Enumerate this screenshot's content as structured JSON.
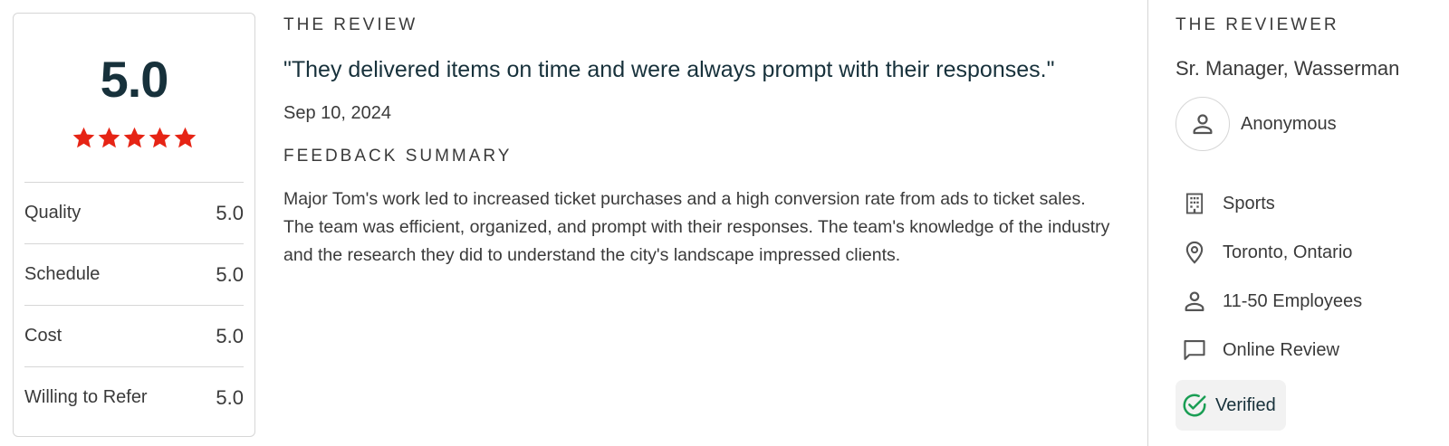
{
  "scorecard": {
    "overall": "5.0",
    "stars": 5,
    "star_color": "#e62415",
    "ratings": [
      {
        "label": "Quality",
        "value": "5.0"
      },
      {
        "label": "Schedule",
        "value": "5.0"
      },
      {
        "label": "Cost",
        "value": "5.0"
      },
      {
        "label": "Willing to Refer",
        "value": "5.0"
      }
    ]
  },
  "review": {
    "heading": "THE REVIEW",
    "quote": "\"They delivered items on time and were always prompt with their responses.\"",
    "date": "Sep 10, 2024",
    "feedback_heading": "FEEDBACK SUMMARY",
    "feedback_text": "Major Tom's work led to increased ticket purchases and a high conversion rate from ads to ticket sales. The team was efficient, organized, and prompt with their responses. The team's knowledge of the industry and the research they did to understand the city's landscape impressed clients."
  },
  "reviewer": {
    "heading": "THE REVIEWER",
    "title": "Sr. Manager, Wasserman",
    "name": "Anonymous",
    "avatar_icon": "person-outline-icon",
    "details": [
      {
        "icon": "building-icon",
        "text": "Sports"
      },
      {
        "icon": "location-pin-icon",
        "text": "Toronto, Ontario"
      },
      {
        "icon": "person-icon",
        "text": "11-50 Employees"
      },
      {
        "icon": "chat-bubble-icon",
        "text": "Online Review"
      }
    ],
    "verified": {
      "icon": "check-circle-icon",
      "label": "Verified",
      "color": "#1a9e54"
    }
  },
  "colors": {
    "heading_dark": "#17313b",
    "text": "#3a3a3a",
    "border": "#d6d6d6",
    "badge_bg": "#f2f2f2"
  }
}
